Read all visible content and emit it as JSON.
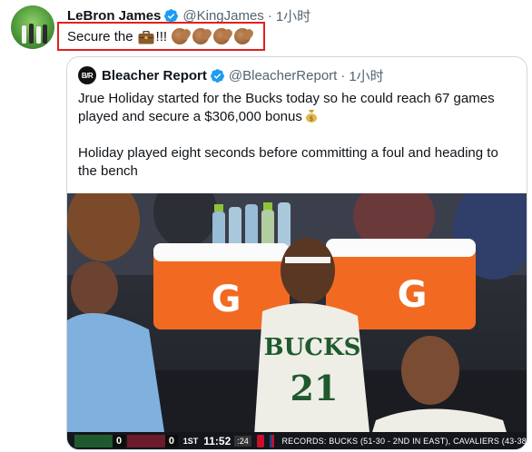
{
  "tweet": {
    "author_name": "LeBron James",
    "handle": "@KingJames",
    "separator": "·",
    "time": "1小时",
    "text_prefix": "Secure the",
    "text_exclaim": "!!!",
    "emoji": [
      "briefcase-icon",
      "clapping-hands-icon",
      "clapping-hands-icon",
      "clapping-hands-icon",
      "clapping-hands-icon"
    ]
  },
  "quoted": {
    "author_name": "Bleacher Report",
    "logo_text": "B/R",
    "handle": "@BleacherReport",
    "separator": "·",
    "time": "1小时",
    "paragraph1": "Jrue Holiday started for the Bucks today so he could reach 67 games played and secure a $306,000 bonus",
    "paragraph2": "Holiday played eight seconds before committing a foul and heading to the bench",
    "media": {
      "jersey_text": "BUCKS",
      "jersey_number": "21",
      "cooler_logo_glyph": "G",
      "scorebug": {
        "home_score": "0",
        "away_score": "0",
        "quarter": "1ST",
        "clock": "11:52",
        "shot_clock": ":24",
        "records": "RECORDS: BUCKS (51-30 - 2ND IN EAST), CAVALIERS (43-38"
      }
    }
  },
  "colors": {
    "verified_blue": "#1d9bf0",
    "highlight_red": "#e0201e",
    "muted_text": "#536471",
    "cooler_orange": "#f26a21"
  }
}
